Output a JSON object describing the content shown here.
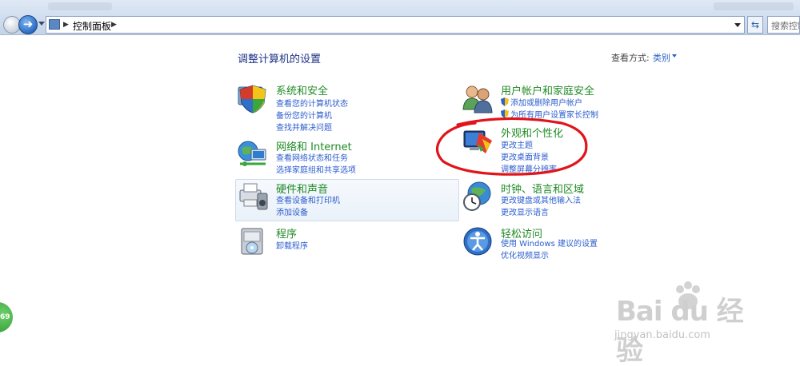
{
  "address_bar": {
    "path": "控制面板",
    "search_placeholder": "搜索控制面板"
  },
  "header": {
    "title": "调整计算机的设置",
    "view_by_label": "查看方式:",
    "view_by_value": "类别"
  },
  "categories": [
    {
      "title": "系统和安全",
      "icon": "shield-computer-icon",
      "links": [
        "查看您的计算机状态",
        "备份您的计算机",
        "查找并解决问题"
      ]
    },
    {
      "title": "网络和 Internet",
      "icon": "network-globe-icon",
      "links": [
        "查看网络状态和任务",
        "选择家庭组和共享选项"
      ]
    },
    {
      "title": "硬件和声音",
      "icon": "printer-speaker-icon",
      "links": [
        "查看设备和打印机",
        "添加设备"
      ]
    },
    {
      "title": "程序",
      "icon": "programs-disk-icon",
      "links": [
        "卸载程序"
      ]
    },
    {
      "title": "用户帐户和家庭安全",
      "icon": "users-icon",
      "links": [
        "添加或删除用户帐户",
        "为所有用户设置家长控制"
      ]
    },
    {
      "title": "外观和个性化",
      "icon": "monitor-paint-icon",
      "links": [
        "更改主题",
        "更改桌面背景",
        "调整屏幕分辨率"
      ]
    },
    {
      "title": "时钟、语言和区域",
      "icon": "clock-globe-icon",
      "links": [
        "更改键盘或其他输入法",
        "更改显示语言"
      ]
    },
    {
      "title": "轻松访问",
      "icon": "ease-of-access-icon",
      "links": [
        "使用 Windows 建议的设置",
        "优化视频显示"
      ]
    }
  ],
  "overlay": {
    "badge_text": "69",
    "watermark_main": "Bai du 经验",
    "watermark_sub": "jingyan.baidu.com"
  },
  "colors": {
    "category_title": "#208a25",
    "link": "#2c5dcd",
    "annotation_ring": "#e0141a"
  }
}
